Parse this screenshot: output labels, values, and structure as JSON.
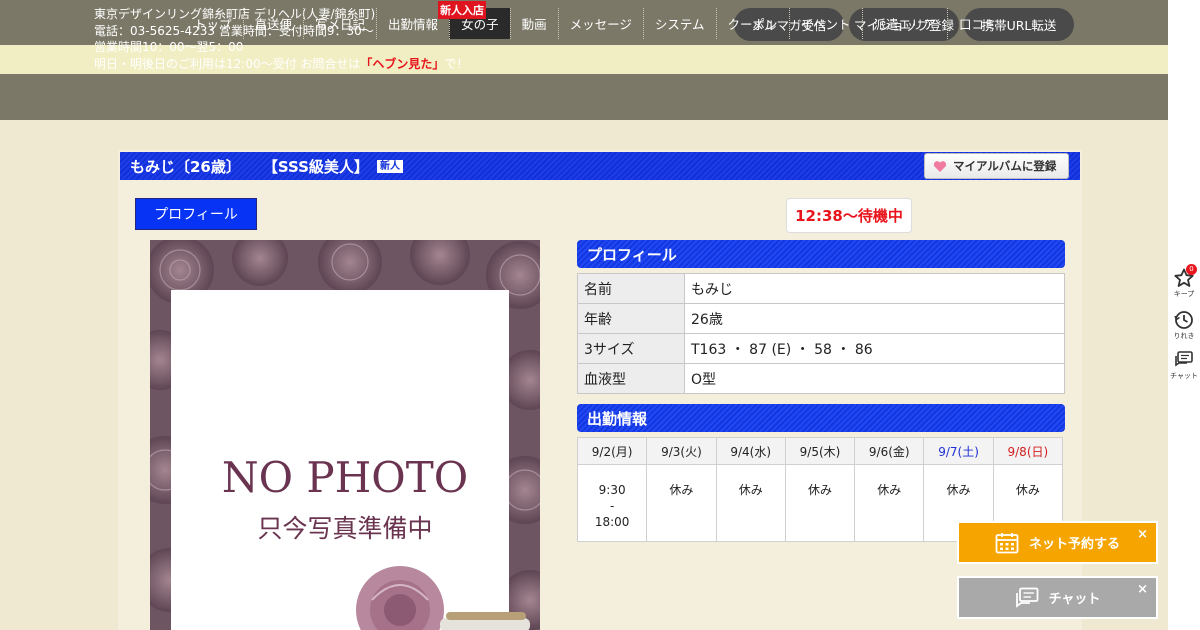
{
  "shop": {
    "line1": "東京デザインリング錦糸町店 デリヘル(人妻/錦糸町)",
    "line2": "電話：03-5625-4233 営業時間：受付時間9：30～",
    "line3": "営業時間10：00～翌5：00",
    "line4_pre": "明日・明後日のご利用は12:00～受付 お問合せは",
    "line4_highlight": "「ヘブン見た」",
    "line4_post": "で！"
  },
  "header_buttons": [
    {
      "label": "メルマガ受信"
    },
    {
      "label": "マイショップ登録"
    },
    {
      "label": "携帯URL転送"
    }
  ],
  "nav": {
    "items": [
      {
        "label": "トップ"
      },
      {
        "label": "直送便"
      },
      {
        "label": "写メ日記"
      },
      {
        "label": "出勤情報"
      },
      {
        "label": "女の子",
        "active": true,
        "badge": "新人入店"
      },
      {
        "label": "動画"
      },
      {
        "label": "メッセージ"
      },
      {
        "label": "システム"
      },
      {
        "label": "クーポン"
      },
      {
        "label": "イベント"
      },
      {
        "label": "派遣エリア"
      },
      {
        "label": "口コミ"
      }
    ]
  },
  "girl": {
    "title_name": "もみじ〔26歳〕",
    "title_catch": "【SSS級美人】",
    "new_tag": "新人",
    "album_button": "マイアルバムに登録",
    "profile_tab": "プロフィール",
    "status": "12:38～待機中"
  },
  "photo": {
    "line1": "NO PHOTO",
    "line2": "只今写真準備中"
  },
  "profile": {
    "heading": "プロフィール",
    "rows": [
      {
        "key": "名前",
        "value": "もみじ"
      },
      {
        "key": "年齢",
        "value": "26歳"
      },
      {
        "key": "3サイズ",
        "value": "T163 ・ 87 (E) ・ 58 ・ 86"
      },
      {
        "key": "血液型",
        "value": "O型"
      }
    ]
  },
  "schedule": {
    "heading": "出勤情報",
    "days": [
      {
        "date": "9/2(月)",
        "value_lines": [
          "9:30",
          "-",
          "18:00"
        ],
        "type": "weekday"
      },
      {
        "date": "9/3(火)",
        "value_lines": [
          "休み"
        ],
        "type": "weekday"
      },
      {
        "date": "9/4(水)",
        "value_lines": [
          "休み"
        ],
        "type": "weekday"
      },
      {
        "date": "9/5(木)",
        "value_lines": [
          "休み"
        ],
        "type": "weekday"
      },
      {
        "date": "9/6(金)",
        "value_lines": [
          "休み"
        ],
        "type": "weekday"
      },
      {
        "date": "9/7(土)",
        "value_lines": [
          "休み"
        ],
        "type": "sat"
      },
      {
        "date": "9/8(日)",
        "value_lines": [
          "休み"
        ],
        "type": "sun"
      }
    ]
  },
  "side_tools": {
    "keep_label": "キープ",
    "keep_count": "0",
    "history_label": "りれき",
    "chat_label": "チャット"
  },
  "floating": {
    "reserve_label": "ネット予約する",
    "reserve_color": "#f5a400",
    "chat_label": "チャット",
    "chat_color": "#a9a9a9",
    "close_glyph": "×"
  }
}
